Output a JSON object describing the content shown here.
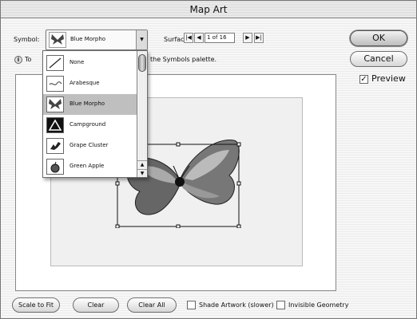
{
  "window": {
    "title": "Map Art"
  },
  "symbol": {
    "label": "Symbol:",
    "selected": "Blue Morpho",
    "hint_left": "To",
    "hint_right": "the Symbols palette.",
    "options": [
      "None",
      "Arabesque",
      "Blue Morpho",
      "Campground",
      "Grape Cluster",
      "Green Apple"
    ],
    "selected_index": 2
  },
  "surface": {
    "label": "Surface:",
    "value": "1 of 16",
    "first": "|◀",
    "prev": "◀",
    "next": "▶",
    "last": "▶|"
  },
  "buttons": {
    "ok": "OK",
    "cancel": "Cancel",
    "scale_to_fit": "Scale to Fit",
    "clear": "Clear",
    "clear_all": "Clear All"
  },
  "preview": {
    "label": "Preview",
    "checked": true
  },
  "shade": {
    "label": "Shade Artwork (slower)",
    "checked": false
  },
  "invisible": {
    "label": "Invisible Geometry",
    "checked": false
  },
  "icons": [
    "info-icon",
    "butterfly-icon",
    "none-slash-icon",
    "arabesque-icon",
    "campground-icon",
    "grape-cluster-icon",
    "green-apple-icon",
    "chevron-down-icon",
    "checkmark-icon"
  ]
}
